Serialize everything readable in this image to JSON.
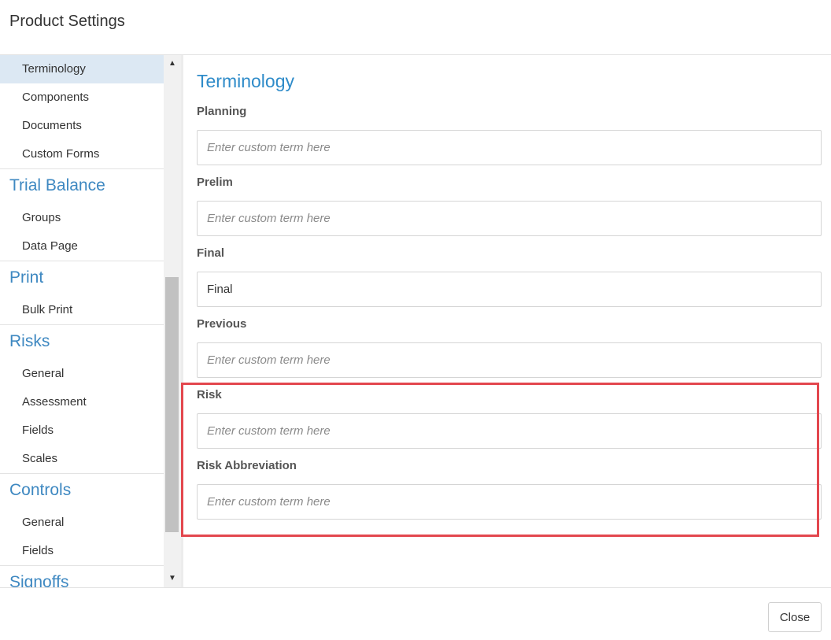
{
  "window": {
    "title": "Product Settings"
  },
  "sidebar": {
    "items": [
      {
        "type": "item",
        "label": "Terminology",
        "active": true
      },
      {
        "type": "item",
        "label": "Components"
      },
      {
        "type": "item",
        "label": "Documents"
      },
      {
        "type": "item",
        "label": "Custom Forms"
      },
      {
        "type": "section",
        "label": "Trial Balance"
      },
      {
        "type": "item",
        "label": "Groups"
      },
      {
        "type": "item",
        "label": "Data Page"
      },
      {
        "type": "section",
        "label": "Print"
      },
      {
        "type": "item",
        "label": "Bulk Print"
      },
      {
        "type": "section",
        "label": "Risks"
      },
      {
        "type": "item",
        "label": "General"
      },
      {
        "type": "item",
        "label": "Assessment"
      },
      {
        "type": "item",
        "label": "Fields"
      },
      {
        "type": "item",
        "label": "Scales"
      },
      {
        "type": "section",
        "label": "Controls"
      },
      {
        "type": "item",
        "label": "General"
      },
      {
        "type": "item",
        "label": "Fields"
      },
      {
        "type": "section",
        "label": "Signoffs"
      }
    ]
  },
  "main": {
    "title": "Terminology",
    "fields": [
      {
        "label": "Planning",
        "value": "",
        "placeholder": "Enter custom term here"
      },
      {
        "label": "Prelim",
        "value": "",
        "placeholder": "Enter custom term here"
      },
      {
        "label": "Final",
        "value": "Final",
        "placeholder": "Enter custom term here"
      },
      {
        "label": "Previous",
        "value": "",
        "placeholder": "Enter custom term here"
      },
      {
        "label": "Risk",
        "value": "",
        "placeholder": "Enter custom term here"
      },
      {
        "label": "Risk Abbreviation",
        "value": "",
        "placeholder": "Enter custom term here"
      }
    ]
  },
  "footer": {
    "close_label": "Close"
  },
  "colors": {
    "accent": "#2e8bc9",
    "section": "#3e88c1",
    "active_bg": "#dce8f3",
    "highlight": "#e3474e"
  },
  "icons": {
    "scroll_up": "triangle-up-icon",
    "scroll_down": "triangle-down-icon"
  }
}
